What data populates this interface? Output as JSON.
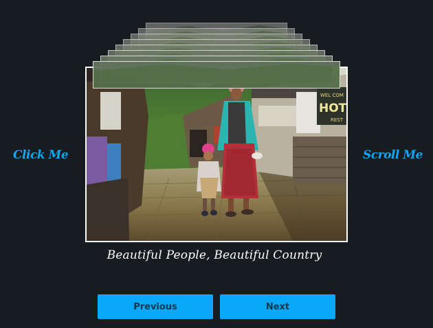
{
  "side_left_label": "Click Me",
  "side_right_label": "Scroll Me",
  "caption": "Beautiful People, Beautiful Country",
  "buttons": {
    "previous": "Previous",
    "next": "Next"
  },
  "photo": {
    "sign_text_top": "WEL COM",
    "sign_text_main": "HOT",
    "sign_text_sub": "REST"
  },
  "colors": {
    "background": "#171c21",
    "accent": "#0aa8f6",
    "button_text": "#12384e"
  },
  "stack_count": 8
}
